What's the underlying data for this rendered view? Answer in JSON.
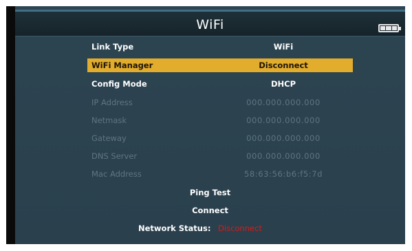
{
  "header": {
    "title": "WiFi",
    "battery_icon": "battery-full-icon"
  },
  "settings": [
    {
      "label": "Link Type",
      "value": "WiFi",
      "state": "active"
    },
    {
      "label": "WiFi Manager",
      "value": "Disconnect",
      "state": "selected"
    },
    {
      "label": "Config Mode",
      "value": "DHCP",
      "state": "active"
    },
    {
      "label": "IP Address",
      "value": "000.000.000.000",
      "state": "disabled"
    },
    {
      "label": "Netmask",
      "value": "000.000.000.000",
      "state": "disabled"
    },
    {
      "label": "Gateway",
      "value": "000.000.000.000",
      "state": "disabled"
    },
    {
      "label": "DNS Server",
      "value": "000.000.000.000",
      "state": "disabled"
    },
    {
      "label": "Mac Address",
      "value": "58:63:56:b6:f5:7d",
      "state": "disabled"
    }
  ],
  "actions": {
    "ping_test": "Ping Test",
    "connect": "Connect"
  },
  "status": {
    "label": "Network Status:",
    "value": "Disconnect"
  },
  "colors": {
    "highlight": "#e2ac2c",
    "status_error": "#d71a18",
    "panel": "#2d4451"
  }
}
